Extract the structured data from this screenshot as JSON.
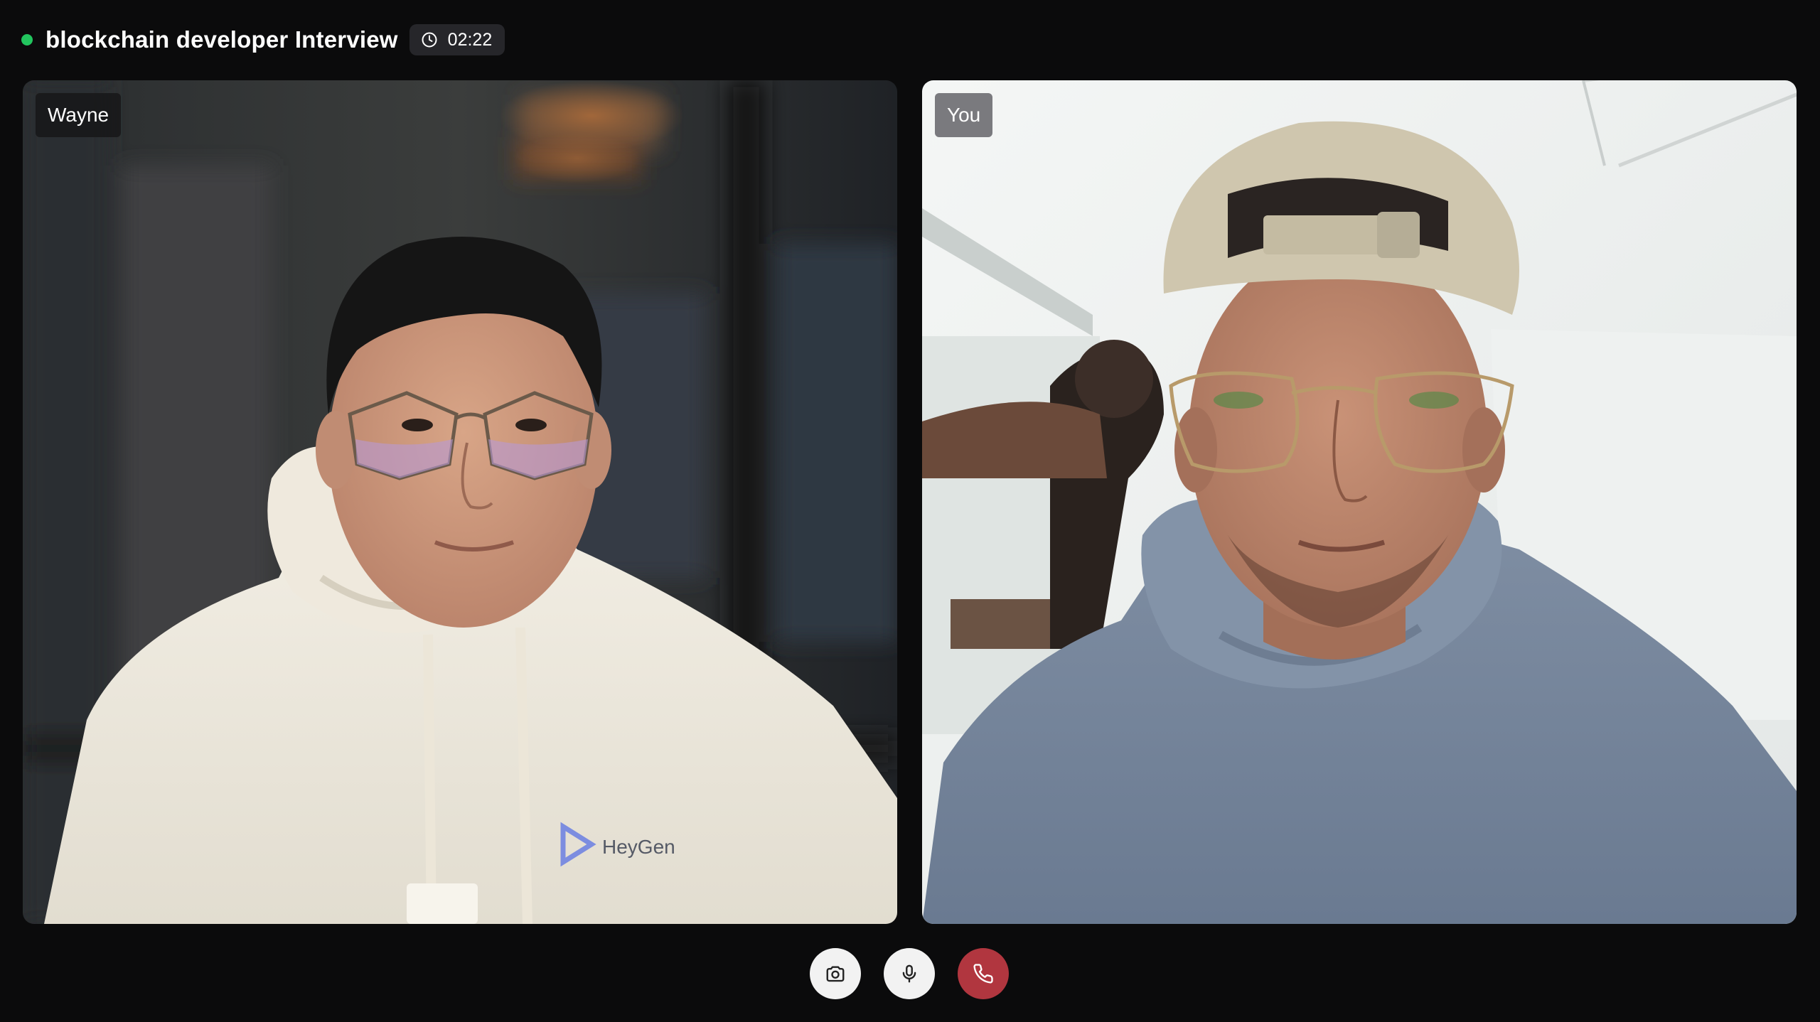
{
  "header": {
    "status": "live",
    "status_color": "#22c55e",
    "title": "blockchain developer Interview",
    "timer_icon": "clock-icon",
    "elapsed": "02:22"
  },
  "participants": [
    {
      "id": "remote",
      "name": "Wayne",
      "hoodie_logo_text": "HeyGen"
    },
    {
      "id": "self",
      "name": "You"
    }
  ],
  "controls": [
    {
      "id": "camera",
      "icon": "camera-icon"
    },
    {
      "id": "microphone",
      "icon": "microphone-icon"
    },
    {
      "id": "end-call",
      "icon": "phone-icon",
      "color": "#b1363f"
    }
  ]
}
